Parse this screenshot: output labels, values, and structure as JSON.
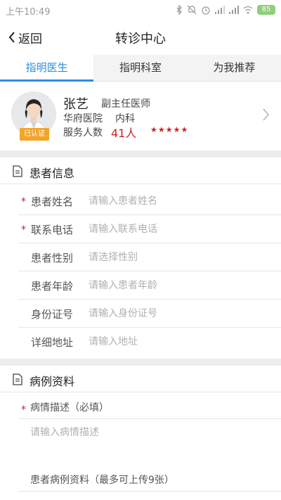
{
  "status_bar": {
    "time": "上午10:49",
    "battery": "85",
    "icons": [
      "bluetooth-icon",
      "mute-icon",
      "alarm-icon",
      "signal-icon",
      "signal-icon",
      "wifi-icon",
      "battery-icon"
    ]
  },
  "nav": {
    "back_label": "返回",
    "title": "转诊中心"
  },
  "tabs": [
    {
      "label": "指明医生",
      "active": true
    },
    {
      "label": "指明科室",
      "active": false
    },
    {
      "label": "为我推荐",
      "active": false
    }
  ],
  "doctor": {
    "name": "张艺",
    "title": "副主任医师",
    "hospital": "华府医院",
    "department": "内科",
    "served_label": "服务人数",
    "served_count": "41人",
    "rating": 5,
    "verified_label": "已认证"
  },
  "patient_section": {
    "title": "患者信息",
    "fields": [
      {
        "label": "患者姓名",
        "placeholder": "请输入患者姓名",
        "required": true,
        "value": ""
      },
      {
        "label": "联系电话",
        "placeholder": "请输入联系电话",
        "required": true,
        "value": ""
      },
      {
        "label": "患者性别",
        "placeholder": "请选择性别",
        "required": false,
        "value": ""
      },
      {
        "label": "患者年龄",
        "placeholder": "请输入患者年龄",
        "required": false,
        "value": ""
      },
      {
        "label": "身份证号",
        "placeholder": "请输入身份证号",
        "required": false,
        "value": ""
      },
      {
        "label": "详细地址",
        "placeholder": "请输入地址",
        "required": false,
        "value": ""
      }
    ]
  },
  "case_section": {
    "title": "病例资料",
    "description_label": "病情描述（必填）",
    "description_placeholder": "请输入病情描述",
    "description_value": "",
    "upload_label": "患者病例资料（最多可上传9张）"
  },
  "colors": {
    "accent": "#2a8ee0",
    "required": "#cc2222",
    "badge": "#f4a428",
    "battery": "#8fcf7a"
  }
}
